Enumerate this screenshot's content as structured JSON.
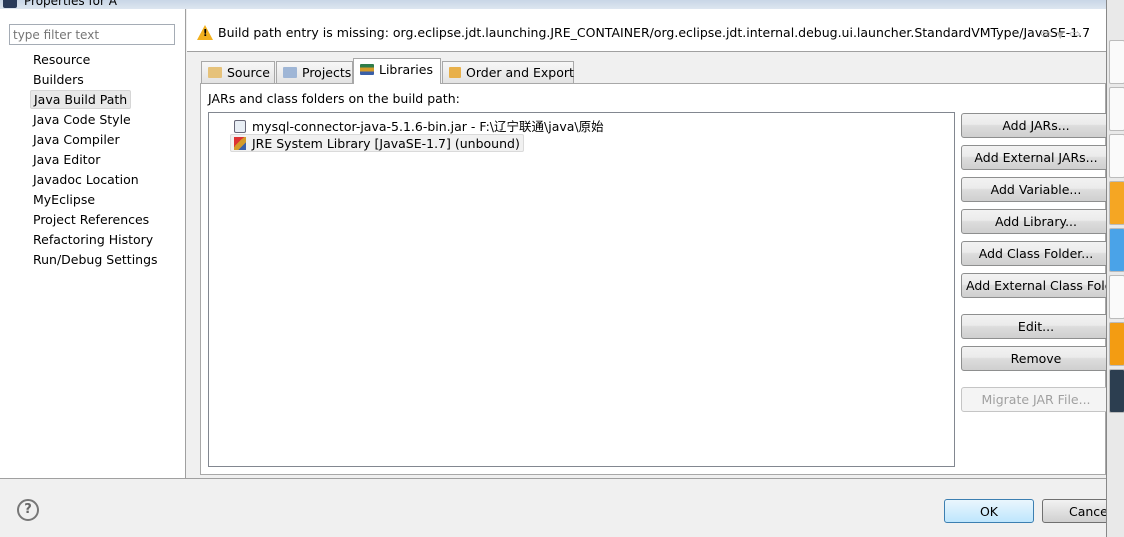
{
  "window": {
    "title": "Properties for A"
  },
  "sidebar": {
    "filter_placeholder": "type filter text",
    "items": [
      {
        "label": "Resource"
      },
      {
        "label": "Builders"
      },
      {
        "label": "Java Build Path",
        "selected": true
      },
      {
        "label": "Java Code Style"
      },
      {
        "label": "Java Compiler"
      },
      {
        "label": "Java Editor"
      },
      {
        "label": "Javadoc Location"
      },
      {
        "label": "MyEclipse"
      },
      {
        "label": "Project References"
      },
      {
        "label": "Refactoring History"
      },
      {
        "label": "Run/Debug Settings"
      }
    ]
  },
  "header": {
    "icon": "warning-icon",
    "message": "Build path entry is missing: org.eclipse.jdt.launching.JRE_CONTAINER/org.eclipse.jdt.internal.debug.ui.launcher.StandardVMType/JavaSE-1.7"
  },
  "tabs": [
    {
      "label": "Source"
    },
    {
      "label": "Projects"
    },
    {
      "label": "Libraries",
      "active": true
    },
    {
      "label": "Order and Export"
    }
  ],
  "libraries": {
    "label": "JARs and class folders on the build path:",
    "entries": [
      {
        "label": "mysql-connector-java-5.1.6-bin.jar - F:\\辽宁联通\\java\\原始",
        "icon": "jar-icon"
      },
      {
        "label": "JRE System Library [JavaSE-1.7] (unbound)",
        "icon": "library-error-icon",
        "selected": true
      }
    ],
    "buttons": [
      {
        "label": "Add JARs..."
      },
      {
        "label": "Add External JARs..."
      },
      {
        "label": "Add Variable..."
      },
      {
        "label": "Add Library..."
      },
      {
        "label": "Add Class Folder..."
      },
      {
        "label": "Add External Class Folder..."
      },
      {
        "label": "Edit..."
      },
      {
        "label": "Remove"
      },
      {
        "label": "Migrate JAR File...",
        "disabled": true
      }
    ]
  },
  "footer": {
    "ok": "OK",
    "cancel": "Cancel",
    "help": "?"
  }
}
